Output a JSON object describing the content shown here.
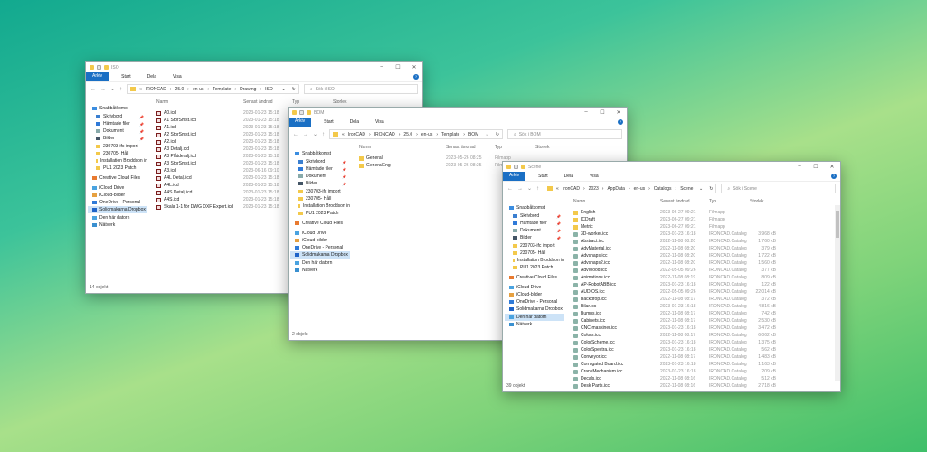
{
  "sidebar": [
    "Snabbåtkomst",
    "Skrivbord",
    "Hämtade filer",
    "Dokument",
    "Bilder",
    "230703-ifc import",
    "230705- Håll",
    "Installation Broddson in",
    "PU1 2023 Patch",
    "Creative Cloud Files",
    "iCloud Drive",
    "iCloud-bilder",
    "OneDrive - Personal",
    "Solidmakarna Dropbox",
    "Den här datorn",
    "Nätverk"
  ],
  "ribbon": [
    "Arkiv",
    "Start",
    "Dela",
    "Visa"
  ],
  "columns": [
    "Namn",
    "Senast ändrad",
    "Typ",
    "Storlek"
  ],
  "windows": [
    {
      "title": "ISO",
      "path": [
        "IRONCAD",
        "25.0",
        "en-us",
        "Template",
        "Drawing",
        "ISO"
      ],
      "search": "Sök i ISO",
      "status": "14 objekt",
      "selected_sidebar": "Solidmakarna Dropbox",
      "files": [
        {
          "name": "A0.icd",
          "date": "2023-01-23 15:18",
          "type": "",
          "size": "",
          "kind": "icd"
        },
        {
          "name": "A1 StorSmst.icd",
          "date": "2023-01-23 15:18",
          "type": "",
          "size": "",
          "kind": "icd"
        },
        {
          "name": "A1.icd",
          "date": "2023-01-23 15:18",
          "type": "",
          "size": "",
          "kind": "icd"
        },
        {
          "name": "A2 StorSmst.icd",
          "date": "2023-01-23 15:18",
          "type": "",
          "size": "",
          "kind": "icd"
        },
        {
          "name": "A2.icd",
          "date": "2023-01-23 15:18",
          "type": "",
          "size": "",
          "kind": "icd"
        },
        {
          "name": "A3 Detalj.icd",
          "date": "2023-01-23 15:18",
          "type": "",
          "size": "",
          "kind": "icd"
        },
        {
          "name": "A3 Plåtdetalj.icd",
          "date": "2023-01-23 15:18",
          "type": "",
          "size": "",
          "kind": "icd"
        },
        {
          "name": "A3 StorSmst.icd",
          "date": "2023-01-23 15:18",
          "type": "",
          "size": "",
          "kind": "icd"
        },
        {
          "name": "A3.icd",
          "date": "2023-06-16 09:10",
          "type": "",
          "size": "",
          "kind": "icd"
        },
        {
          "name": "A4L Detalj.icd",
          "date": "2023-01-23 15:18",
          "type": "",
          "size": "",
          "kind": "icd"
        },
        {
          "name": "A4L.icd",
          "date": "2023-01-23 15:18",
          "type": "",
          "size": "",
          "kind": "icd"
        },
        {
          "name": "A4S Detalj.icd",
          "date": "2023-01-23 15:18",
          "type": "",
          "size": "",
          "kind": "icd"
        },
        {
          "name": "A4S.icd",
          "date": "2023-01-23 15:18",
          "type": "",
          "size": "",
          "kind": "icd"
        },
        {
          "name": "Skala 1-1 för DWG DXF Export.icd",
          "date": "2023-01-23 15:18",
          "type": "",
          "size": "",
          "kind": "icd"
        }
      ]
    },
    {
      "title": "BOM",
      "path": [
        "IronCAD",
        "IRONCAD",
        "25.0",
        "en-us",
        "Template",
        "BOM"
      ],
      "search": "Sök i BOM",
      "status": "2 objekt",
      "selected_sidebar": "Solidmakarna Dropbox",
      "files": [
        {
          "name": "General",
          "date": "2023-05-26 08:25",
          "type": "Filmapp",
          "size": "",
          "kind": "folder"
        },
        {
          "name": "GeneralEng",
          "date": "2023-05-26 08:25",
          "type": "Filmapp",
          "size": "",
          "kind": "folder"
        }
      ]
    },
    {
      "title": "Scene",
      "path": [
        "IronCAD",
        "2023",
        "AppData",
        "en-us",
        "Catalogs",
        "Scene"
      ],
      "search": "Sök i Scene",
      "status": "39 objekt",
      "selected_sidebar": "Den här datorn",
      "files": [
        {
          "name": "English",
          "date": "2023-06-27 09:21",
          "type": "Filmapp",
          "size": "",
          "kind": "folder"
        },
        {
          "name": "ICDraft",
          "date": "2023-06-27 09:21",
          "type": "Filmapp",
          "size": "",
          "kind": "folder"
        },
        {
          "name": "Metric",
          "date": "2023-06-27 09:21",
          "type": "Filmapp",
          "size": "",
          "kind": "folder"
        },
        {
          "name": "3D-worker.icc",
          "date": "2023-01-23 16:18",
          "type": "IRONCAD.Catalog",
          "size": "3 968 kB",
          "kind": "icc"
        },
        {
          "name": "Abstract.icc",
          "date": "2022-11-08 08:20",
          "type": "IRONCAD.Catalog",
          "size": "1 760 kB",
          "kind": "icc"
        },
        {
          "name": "AdvMaterial.icc",
          "date": "2022-11-08 08:20",
          "type": "IRONCAD.Catalog",
          "size": "379 kB",
          "kind": "icc"
        },
        {
          "name": "Advshaps.icc",
          "date": "2022-11-08 08:20",
          "type": "IRONCAD.Catalog",
          "size": "1 722 kB",
          "kind": "icc"
        },
        {
          "name": "Advshaps2.icc",
          "date": "2022-11-08 08:20",
          "type": "IRONCAD.Catalog",
          "size": "1 560 kB",
          "kind": "icc"
        },
        {
          "name": "AdvWood.icc",
          "date": "2022-05-05 09:26",
          "type": "IRONCAD.Catalog",
          "size": "377 kB",
          "kind": "icc"
        },
        {
          "name": "Animations.icc",
          "date": "2022-11-08 08:19",
          "type": "IRONCAD.Catalog",
          "size": "809 kB",
          "kind": "icc"
        },
        {
          "name": "AP-RobotABB.icc",
          "date": "2023-01-23 16:18",
          "type": "IRONCAD.Catalog",
          "size": "122 kB",
          "kind": "icc"
        },
        {
          "name": "AUDIOS.icc",
          "date": "2022-05-05 09:26",
          "type": "IRONCAD.Catalog",
          "size": "22 014 kB",
          "kind": "icc"
        },
        {
          "name": "Backdrop.icc",
          "date": "2022-11-08 08:17",
          "type": "IRONCAD.Catalog",
          "size": "372 kB",
          "kind": "icc"
        },
        {
          "name": "Bilar.icc",
          "date": "2023-01-23 16:18",
          "type": "IRONCAD.Catalog",
          "size": "4 816 kB",
          "kind": "icc"
        },
        {
          "name": "Bumps.icc",
          "date": "2022-11-08 08:17",
          "type": "IRONCAD.Catalog",
          "size": "742 kB",
          "kind": "icc"
        },
        {
          "name": "Cabinets.icc",
          "date": "2022-11-08 08:17",
          "type": "IRONCAD.Catalog",
          "size": "2 530 kB",
          "kind": "icc"
        },
        {
          "name": "CNC-maskiner.icc",
          "date": "2023-01-23 16:18",
          "type": "IRONCAD.Catalog",
          "size": "3 472 kB",
          "kind": "icc"
        },
        {
          "name": "Colors.icc",
          "date": "2022-11-08 08:17",
          "type": "IRONCAD.Catalog",
          "size": "6 062 kB",
          "kind": "icc"
        },
        {
          "name": "ColorScheme.icc",
          "date": "2023-01-23 16:18",
          "type": "IRONCAD.Catalog",
          "size": "1 375 kB",
          "kind": "icc"
        },
        {
          "name": "ColorSpectra.icc",
          "date": "2023-01-23 16:18",
          "type": "IRONCAD.Catalog",
          "size": "562 kB",
          "kind": "icc"
        },
        {
          "name": "Conveyor.icc",
          "date": "2022-11-08 08:17",
          "type": "IRONCAD.Catalog",
          "size": "1 483 kB",
          "kind": "icc"
        },
        {
          "name": "Corrugated Board.icc",
          "date": "2023-01-23 16:18",
          "type": "IRONCAD.Catalog",
          "size": "1 163 kB",
          "kind": "icc"
        },
        {
          "name": "CrankMechanism.icc",
          "date": "2023-01-23 16:18",
          "type": "IRONCAD.Catalog",
          "size": "209 kB",
          "kind": "icc"
        },
        {
          "name": "Decals.icc",
          "date": "2022-11-08 08:16",
          "type": "IRONCAD.Catalog",
          "size": "512 kB",
          "kind": "icc"
        },
        {
          "name": "Desk Parts.icc",
          "date": "2022-11-08 08:16",
          "type": "IRONCAD.Catalog",
          "size": "2 718 kB",
          "kind": "icc"
        }
      ]
    }
  ]
}
